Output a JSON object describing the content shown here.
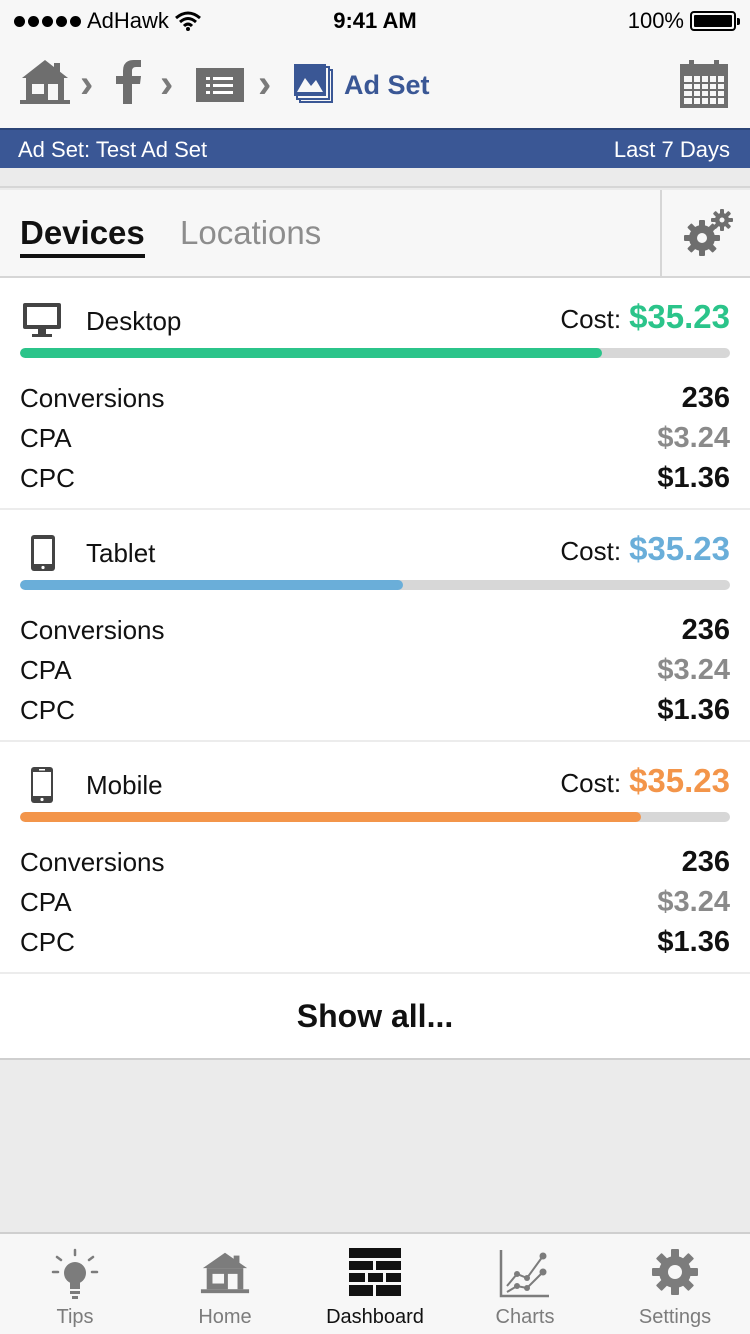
{
  "status_bar": {
    "carrier": "AdHawk",
    "time": "9:41 AM",
    "battery": "100%"
  },
  "nav": {
    "current": "Ad Set",
    "icons": [
      "home-icon",
      "facebook-icon",
      "list-icon",
      "ad-set-icon",
      "calendar-icon"
    ]
  },
  "info_bar": {
    "left": "Ad Set: Test Ad Set",
    "right": "Last 7 Days"
  },
  "tabs": {
    "devices": "Devices",
    "locations": "Locations",
    "active": "Devices"
  },
  "devices": [
    {
      "name": "Desktop",
      "icon": "desktop-icon",
      "cost_label": "Cost:",
      "cost": "$35.23",
      "color": "#2bc48a",
      "bar_fraction": 0.82,
      "metrics": {
        "conversions_label": "Conversions",
        "conversions": "236",
        "cpa_label": "CPA",
        "cpa": "$3.24",
        "cpc_label": "CPC",
        "cpc": "$1.36"
      }
    },
    {
      "name": "Tablet",
      "icon": "tablet-icon",
      "cost_label": "Cost:",
      "cost": "$35.23",
      "color": "#6aaed9",
      "bar_fraction": 0.54,
      "metrics": {
        "conversions_label": "Conversions",
        "conversions": "236",
        "cpa_label": "CPA",
        "cpa": "$3.24",
        "cpc_label": "CPC",
        "cpc": "$1.36"
      }
    },
    {
      "name": "Mobile",
      "icon": "mobile-icon",
      "cost_label": "Cost:",
      "cost": "$35.23",
      "color": "#f3954a",
      "bar_fraction": 0.875,
      "metrics": {
        "conversions_label": "Conversions",
        "conversions": "236",
        "cpa_label": "CPA",
        "cpa": "$3.24",
        "cpc_label": "CPC",
        "cpc": "$1.36"
      }
    }
  ],
  "show_all": "Show all...",
  "colors": {
    "brand": "#3a5795",
    "cpa_gray": "#8a8a8a"
  },
  "tabbar": {
    "tips": "Tips",
    "home": "Home",
    "dashboard": "Dashboard",
    "charts": "Charts",
    "settings": "Settings",
    "active": "Dashboard"
  }
}
